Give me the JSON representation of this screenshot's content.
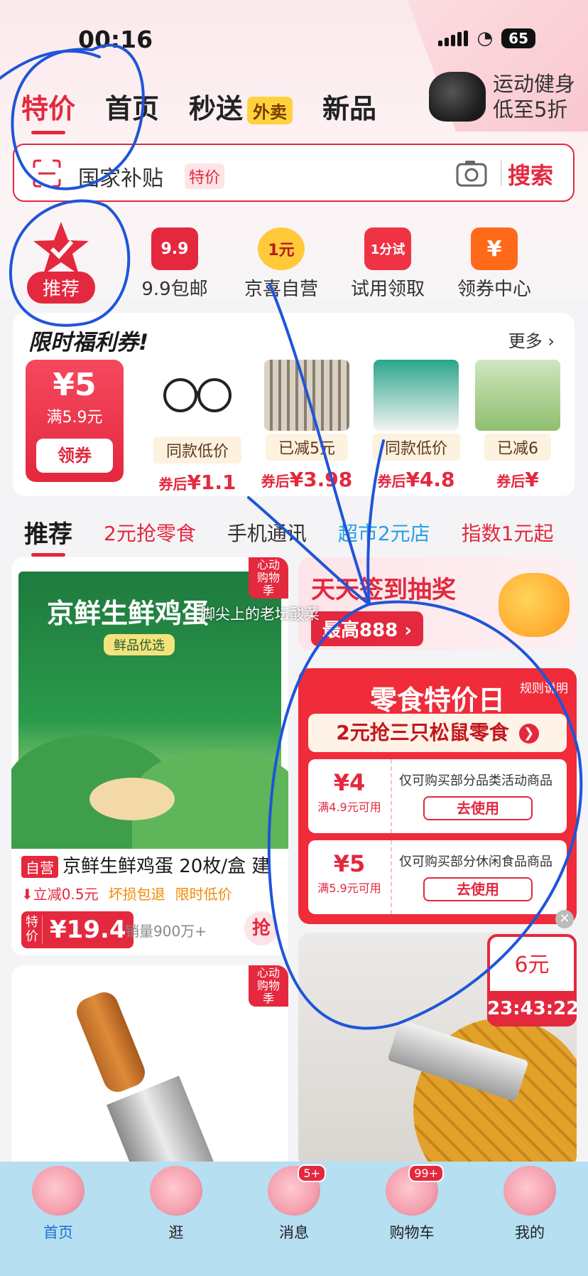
{
  "status": {
    "time": "00:16",
    "battery": "65"
  },
  "top_tabs": [
    {
      "label": "特价"
    },
    {
      "label": "首页"
    },
    {
      "label": "秒送",
      "badge": "外卖"
    },
    {
      "label": "新品"
    }
  ],
  "promo": {
    "line1": "运动健身",
    "line2": "低至5折"
  },
  "search": {
    "text": "国家补贴",
    "tag": "特价",
    "button": "搜索"
  },
  "categories": [
    {
      "label": "推荐"
    },
    {
      "label": "9.9包邮",
      "icon_text": "9.9"
    },
    {
      "label": "京喜自营",
      "icon_text": "1元"
    },
    {
      "label": "试用领取",
      "icon_text": "1分试"
    },
    {
      "label": "领券中心",
      "icon_text": "¥"
    }
  ],
  "coupon_section": {
    "title": "限时福利券!",
    "more": "更多 ›",
    "voucher": {
      "amount": "¥5",
      "condition": "满5.9元",
      "button": "领券"
    },
    "items": [
      {
        "tag": "同款低价",
        "prefix": "券后",
        "price": "¥1.1"
      },
      {
        "tag": "已减5元",
        "prefix": "券后",
        "price": "¥3.98"
      },
      {
        "tag": "同款低价",
        "prefix": "券后",
        "price": "¥4.8"
      },
      {
        "tag": "已减6",
        "prefix": "券后",
        "price": "¥"
      }
    ]
  },
  "feed_tabs": [
    {
      "label": "推荐"
    },
    {
      "label": "2元抢零食",
      "color": "#e4283e"
    },
    {
      "label": "手机通讯",
      "color": "#333333"
    },
    {
      "label": "超市2元店",
      "color": "#27a1e4"
    },
    {
      "label": "指数1元起",
      "color": "#e4283e"
    }
  ],
  "product_card": {
    "badge": "心动购物季",
    "box_title": "京鲜生鲜鸡蛋",
    "box_sub": "鲜品优选",
    "self_tag": "自营",
    "name": "京鲜生鲜鸡蛋 20枚/盒 建",
    "benefit_cut": "立减0.5元",
    "benefit_1": "坏损包退",
    "benefit_2": "限时低价",
    "price_label": "特价",
    "price": "¥19.4",
    "sold": "销量900万+",
    "grab": "抢"
  },
  "signin": {
    "title": "天天签到抽奖",
    "pill": "最高888 ›"
  },
  "snack_day": {
    "title": "零食特价日",
    "rule": "规则说明",
    "banner": "2元抢三只松鼠零食",
    "coupons": [
      {
        "amount": "¥4",
        "condition": "满4.9元可用",
        "desc": "仅可购买部分品类活动商品",
        "button": "去使用"
      },
      {
        "amount": "¥5",
        "condition": "满5.9元可用",
        "desc": "仅可购买部分休闲食品商品",
        "button": "去使用"
      }
    ]
  },
  "flash": {
    "price": "6元",
    "countdown": "23:43:22"
  },
  "knife_card": {
    "badge": "心动购物季"
  },
  "watermark": "脚尖上的老坛酸菜",
  "bottom_nav": [
    {
      "label": "首页"
    },
    {
      "label": "逛"
    },
    {
      "label": "消息",
      "badge": "5+"
    },
    {
      "label": "购物车",
      "badge": "99+"
    },
    {
      "label": "我的"
    }
  ]
}
